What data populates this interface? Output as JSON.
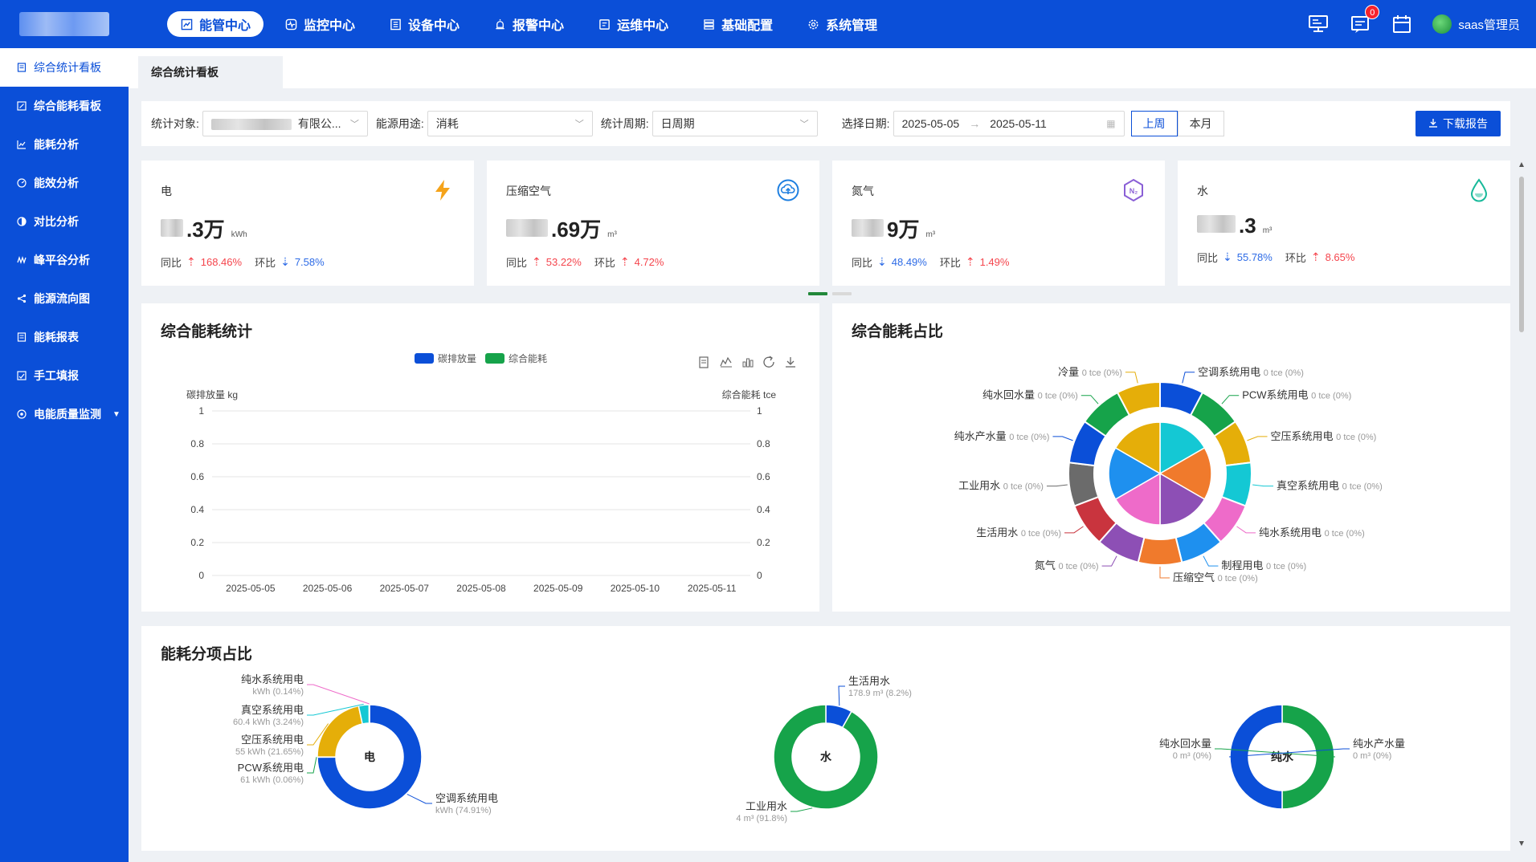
{
  "nav": {
    "items": [
      {
        "label": "能管中心",
        "icon": "chart-icon",
        "active": true
      },
      {
        "label": "监控中心",
        "icon": "pulse-icon"
      },
      {
        "label": "设备中心",
        "icon": "list-icon"
      },
      {
        "label": "报警中心",
        "icon": "alarm-icon"
      },
      {
        "label": "运维中心",
        "icon": "clipboard-icon"
      },
      {
        "label": "基础配置",
        "icon": "grid-icon"
      },
      {
        "label": "系统管理",
        "icon": "gear-icon"
      }
    ],
    "badge_count": "0",
    "user_name": "saas管理员"
  },
  "sidebar": {
    "items": [
      {
        "label": "综合统计看板",
        "active": true
      },
      {
        "label": "综合能耗看板"
      },
      {
        "label": "能耗分析"
      },
      {
        "label": "能效分析"
      },
      {
        "label": "对比分析"
      },
      {
        "label": "峰平谷分析"
      },
      {
        "label": "能源流向图"
      },
      {
        "label": "能耗报表"
      },
      {
        "label": "手工填报"
      },
      {
        "label": "电能质量监测"
      }
    ]
  },
  "tabs": {
    "active": "综合统计看板"
  },
  "filters": {
    "target_label": "统计对象:",
    "target_value": "有限公...",
    "usage_label": "能源用途:",
    "usage_value": "消耗",
    "period_label": "统计周期:",
    "period_value": "日周期",
    "date_label": "选择日期:",
    "date_start": "2025-05-05",
    "date_end": "2025-05-11",
    "btn_last_week": "上周",
    "btn_this_month": "本月",
    "btn_download": "下载报告"
  },
  "cards": [
    {
      "title": "电",
      "value_suffix": ".3万",
      "unit": "kWh",
      "yoy_label": "同比",
      "yoy": "168.46%",
      "yoy_dir": "up",
      "mom_label": "环比",
      "mom": "7.58%",
      "mom_dir": "down",
      "icon": "lightning-icon"
    },
    {
      "title": "压缩空气",
      "value_suffix": ".69万",
      "unit": "m³",
      "yoy_label": "同比",
      "yoy": "53.22%",
      "yoy_dir": "up",
      "mom_label": "环比",
      "mom": "4.72%",
      "mom_dir": "up",
      "icon": "cloud-upload-icon"
    },
    {
      "title": "氮气",
      "value_suffix": "9万",
      "unit": "m³",
      "yoy_label": "同比",
      "yoy": "48.49%",
      "yoy_dir": "down",
      "mom_label": "环比",
      "mom": "1.49%",
      "mom_dir": "up",
      "icon": "n2-hexagon-icon"
    },
    {
      "title": "水",
      "value_suffix": ".3",
      "unit": "m³",
      "yoy_label": "同比",
      "yoy": "55.78%",
      "yoy_dir": "down",
      "mom_label": "环比",
      "mom": "8.65%",
      "mom_dir": "up",
      "icon": "water-drop-icon"
    }
  ],
  "panels": {
    "stats_title": "综合能耗统计",
    "share_title": "综合能耗占比",
    "breakdown_title": "能耗分项占比"
  },
  "colors": {
    "brand": "#0b4fd8",
    "green": "#16a34a",
    "up": "#f5454d",
    "down": "#2d6be6"
  },
  "chart_data": [
    {
      "type": "line",
      "legend": [
        "碳排放量",
        "综合能耗"
      ],
      "legend_colors": [
        "#0b4fd8",
        "#16a34a"
      ],
      "ylabel_left": "碳排放量 kg",
      "ylabel_right": "综合能耗 tce",
      "y_ticks": [
        "0",
        "0.2",
        "0.4",
        "0.6",
        "0.8",
        "1"
      ],
      "ylim": [
        0,
        1
      ],
      "categories": [
        "2025-05-05",
        "2025-05-06",
        "2025-05-07",
        "2025-05-08",
        "2025-05-09",
        "2025-05-10",
        "2025-05-11"
      ],
      "series": [
        {
          "name": "碳排放量",
          "values": []
        },
        {
          "name": "综合能耗",
          "values": []
        }
      ]
    },
    {
      "type": "pie",
      "slices": [
        {
          "name": "空调系统用电",
          "value": "0 tce",
          "pct": "(0%)",
          "color": "#0b4fd8"
        },
        {
          "name": "PCW系统用电",
          "value": "0 tce",
          "pct": "(0%)",
          "color": "#16a34a"
        },
        {
          "name": "空压系统用电",
          "value": "0 tce",
          "pct": "(0%)",
          "color": "#e5ae09"
        },
        {
          "name": "真空系统用电",
          "value": "0 tce",
          "pct": "(0%)",
          "color": "#14c8d4"
        },
        {
          "name": "纯水系统用电",
          "value": "0 tce",
          "pct": "(0%)",
          "color": "#ee6bc9"
        },
        {
          "name": "制程用电",
          "value": "0 tce",
          "pct": "(0%)",
          "color": "#1e90ef"
        },
        {
          "name": "压缩空气",
          "value": "0 tce",
          "pct": "(0%)",
          "color": "#f07a2c"
        },
        {
          "name": "氮气",
          "value": "0 tce",
          "pct": "(0%)",
          "color": "#8d4fb5"
        },
        {
          "name": "生活用水",
          "value": "0 tce",
          "pct": "(0%)",
          "color": "#c9343e"
        },
        {
          "name": "工业用水",
          "value": "0 tce",
          "pct": "(0%)",
          "color": "#6b6b6b"
        },
        {
          "name": "纯水产水量",
          "value": "0 tce",
          "pct": "(0%)",
          "color": "#0b4fd8"
        },
        {
          "name": "纯水回水量",
          "value": "0 tce",
          "pct": "(0%)",
          "color": "#16a34a"
        },
        {
          "name": "冷量",
          "value": "0 tce",
          "pct": "(0%)",
          "color": "#e5ae09"
        }
      ]
    },
    {
      "type": "pie",
      "center": "电",
      "slices": [
        {
          "name": "空调系统用电",
          "value": "kWh",
          "pct": "(74.91%)",
          "color": "#0b4fd8"
        },
        {
          "name": "PCW系统用电",
          "value": "61 kWh",
          "pct": "(0.06%)",
          "color": "#16a34a"
        },
        {
          "name": "空压系统用电",
          "value": "55 kWh",
          "pct": "(21.65%)",
          "color": "#e5ae09"
        },
        {
          "name": "真空系统用电",
          "value": "60.4 kWh",
          "pct": "(3.24%)",
          "color": "#14c8d4"
        },
        {
          "name": "纯水系统用电",
          "value": "kWh",
          "pct": "(0.14%)",
          "color": "#ee6bc9"
        }
      ]
    },
    {
      "type": "pie",
      "center": "水",
      "slices": [
        {
          "name": "生活用水",
          "value": "178.9 m³",
          "pct": "(8.2%)",
          "color": "#0b4fd8"
        },
        {
          "name": "工业用水",
          "value": "4 m³",
          "pct": "(91.8%)",
          "color": "#16a34a"
        }
      ]
    },
    {
      "type": "pie",
      "center": "纯水",
      "slices": [
        {
          "name": "纯水回水量",
          "value": "0 m³",
          "pct": "(0%)",
          "color": "#16a34a"
        },
        {
          "name": "纯水产水量",
          "value": "0 m³",
          "pct": "(0%)",
          "color": "#0b4fd8"
        }
      ]
    }
  ]
}
